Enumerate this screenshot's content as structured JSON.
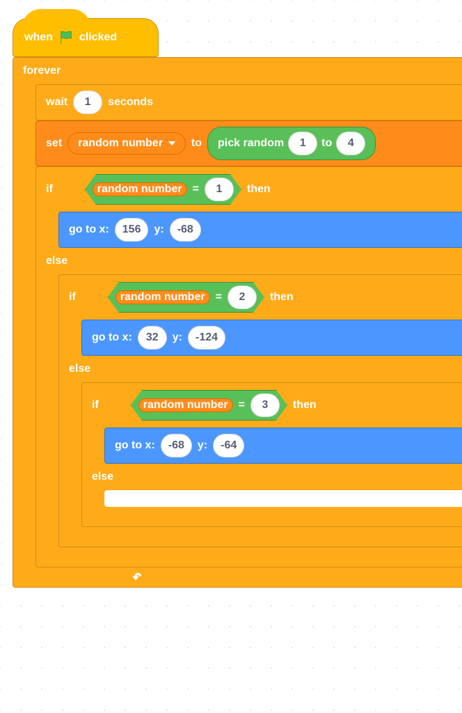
{
  "colors": {
    "events": "#ffbf00",
    "control": "#ffab19",
    "data": "#ff8c1a",
    "operators": "#59c059",
    "motion": "#4c97ff"
  },
  "icons": {
    "flag": "green-flag-icon",
    "loop": "loop-arrow-icon",
    "caret": "dropdown-caret-icon"
  },
  "hat": {
    "when": "when",
    "clicked": "clicked"
  },
  "forever": {
    "label": "forever"
  },
  "wait": {
    "prefix": "wait",
    "seconds": "seconds",
    "value": "1"
  },
  "set": {
    "prefix": "set",
    "to": "to",
    "varname": "random number"
  },
  "pick": {
    "prefix": "pick random",
    "to": "to",
    "min": "1",
    "max": "4"
  },
  "if": {
    "if": "if",
    "then": "then",
    "else": "else",
    "eq": "="
  },
  "vals": {
    "rn": "random number",
    "c1": "1",
    "c2": "2",
    "c3": "3"
  },
  "goto": {
    "prefix": "go to x:",
    "y": "y:"
  },
  "p1": {
    "x": "156",
    "y": "-68"
  },
  "p2": {
    "x": "32",
    "y": "-124"
  },
  "p3": {
    "x": "-68",
    "y": "-64"
  }
}
